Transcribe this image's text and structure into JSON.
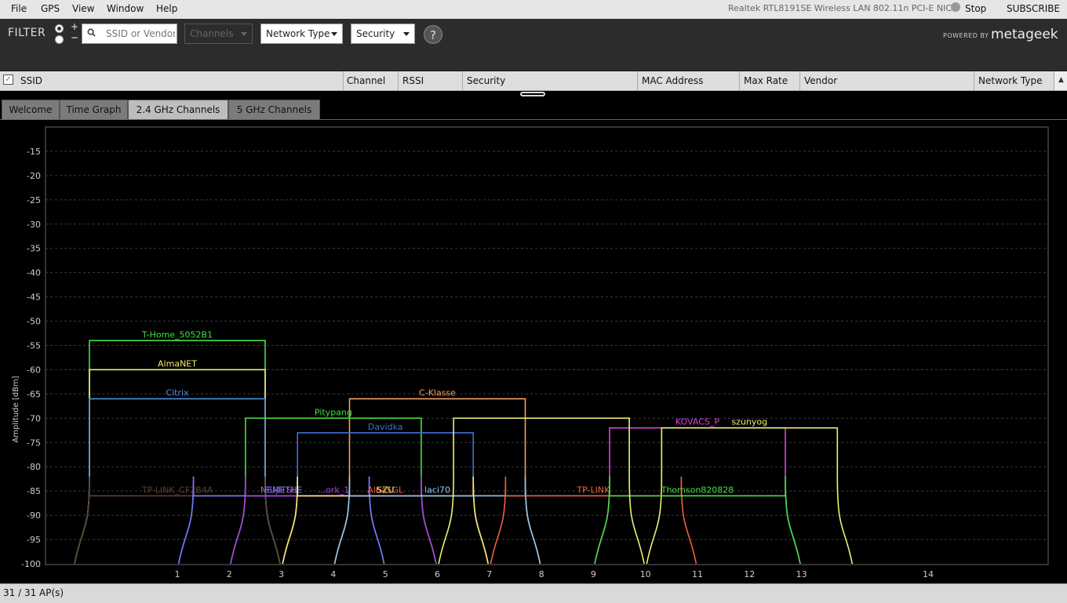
{
  "menu": {
    "items": [
      "File",
      "GPS",
      "View",
      "Window",
      "Help"
    ],
    "adapter": "Realtek RTL8191SE Wireless LAN 802.11n PCI-E NIC",
    "stop": "Stop",
    "subscribe": "SUBSCRIBE"
  },
  "filter": {
    "label": "FILTER",
    "plus": "+",
    "minus": "−",
    "search_placeholder": "SSID or Vendor",
    "channels": "Channels",
    "network_type": "Network Type",
    "security": "Security",
    "help": "?",
    "powered_by": "POWERED BY",
    "brand": "metageek"
  },
  "table": {
    "columns": [
      "SSID",
      "Channel",
      "RSSI",
      "Security",
      "MAC Address",
      "Max Rate",
      "Vendor",
      "Network Type"
    ]
  },
  "tabs": [
    {
      "label": "Welcome",
      "active": false
    },
    {
      "label": "Time Graph",
      "active": false
    },
    {
      "label": "2.4 GHz Channels",
      "active": true
    },
    {
      "label": "5 GHz Channels",
      "active": false
    }
  ],
  "chart_data": {
    "type": "area",
    "ylabel": "Amplitude [dBm]",
    "xlabel": "",
    "ylim": [
      -100,
      -10
    ],
    "yticks": [
      -15,
      -20,
      -25,
      -30,
      -35,
      -40,
      -45,
      -50,
      -55,
      -60,
      -65,
      -70,
      -75,
      -80,
      -85,
      -90,
      -95,
      -100
    ],
    "xticks": [
      1,
      2,
      3,
      4,
      5,
      6,
      7,
      8,
      9,
      10,
      11,
      12,
      13,
      14
    ],
    "grid": true,
    "series": [
      {
        "name": "T-Home_5052B1",
        "channel": 1,
        "rssi": -54,
        "color": "#44e044"
      },
      {
        "name": "AlmaNET",
        "channel": 1,
        "rssi": -60,
        "color": "#f0f070"
      },
      {
        "name": "Citrix",
        "channel": 1,
        "rssi": -66,
        "color": "#4a90e0"
      },
      {
        "name": "C-Klasse",
        "channel": 6,
        "rssi": -66,
        "color": "#f5a05a"
      },
      {
        "name": "Pitypang",
        "channel": 4,
        "rssi": -70,
        "color": "#44e044"
      },
      {
        "name": "Davidka",
        "channel": 5,
        "rssi": -73,
        "color": "#3f6fd8"
      },
      {
        "name": "KOVACS_P",
        "channel": 11,
        "rssi": -72,
        "color": "#e040e0"
      },
      {
        "name": "szunyog",
        "channel": 12,
        "rssi": -72,
        "color": "#f0f070"
      },
      {
        "name": "TP-LINK_CF2B4A",
        "channel": 1,
        "rssi": -86,
        "color": "#5a4030"
      },
      {
        "name": "FUJITSU",
        "channel": 3,
        "rssi": -86,
        "color": "#b040e0"
      },
      {
        "name": "NEMETHE",
        "channel": 3,
        "rssi": -86,
        "color": "#6e7ef0"
      },
      {
        "name": "...ork_1",
        "channel": 4,
        "rssi": -86,
        "color": "#b040e0"
      },
      {
        "name": "AlbaSGL",
        "channel": 5,
        "rssi": -86,
        "color": "#f06040"
      },
      {
        "name": "SZU",
        "channel": 5,
        "rssi": -86,
        "color": "#f0f070"
      },
      {
        "name": "laci70",
        "channel": 6,
        "rssi": -86,
        "color": "#90c8f0"
      },
      {
        "name": "TP-LINK",
        "channel": 9,
        "rssi": -86,
        "color": "#f06040"
      },
      {
        "name": "Thomson820828",
        "channel": 11,
        "rssi": -86,
        "color": "#44e044"
      },
      {
        "name": "",
        "channel": 8,
        "rssi": -70,
        "color": "#f0f070"
      }
    ]
  },
  "status": {
    "text": "31 / 31 AP(s)"
  }
}
